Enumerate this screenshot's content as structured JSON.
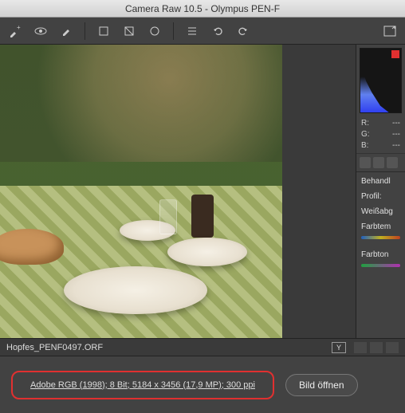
{
  "titlebar": {
    "text": "Camera Raw 10.5 - Olympus PEN-F"
  },
  "toolbar": {
    "icons": [
      "eyedropper-plus",
      "eye",
      "brush",
      "crop",
      "crop2",
      "circle",
      "list",
      "undo",
      "redo"
    ],
    "right_icon": "fullscreen"
  },
  "readout": {
    "r_label": "R:",
    "r_val": "---",
    "g_label": "G:",
    "g_val": "---",
    "b_label": "B:",
    "b_val": "---"
  },
  "panels": {
    "behandlung": "Behandl",
    "profil": "Profil:",
    "weissabgleich": "Weißabg",
    "farbtemperatur": "Farbtem",
    "farbton": "Farbton"
  },
  "file": {
    "name": "Hopfes_PENF0497.ORF",
    "y_label": "Y"
  },
  "footer": {
    "info_link": "Adobe RGB (1998); 8 Bit; 5184 x 3456 (17,9 MP); 300 ppi",
    "open_button": "Bild öffnen"
  }
}
